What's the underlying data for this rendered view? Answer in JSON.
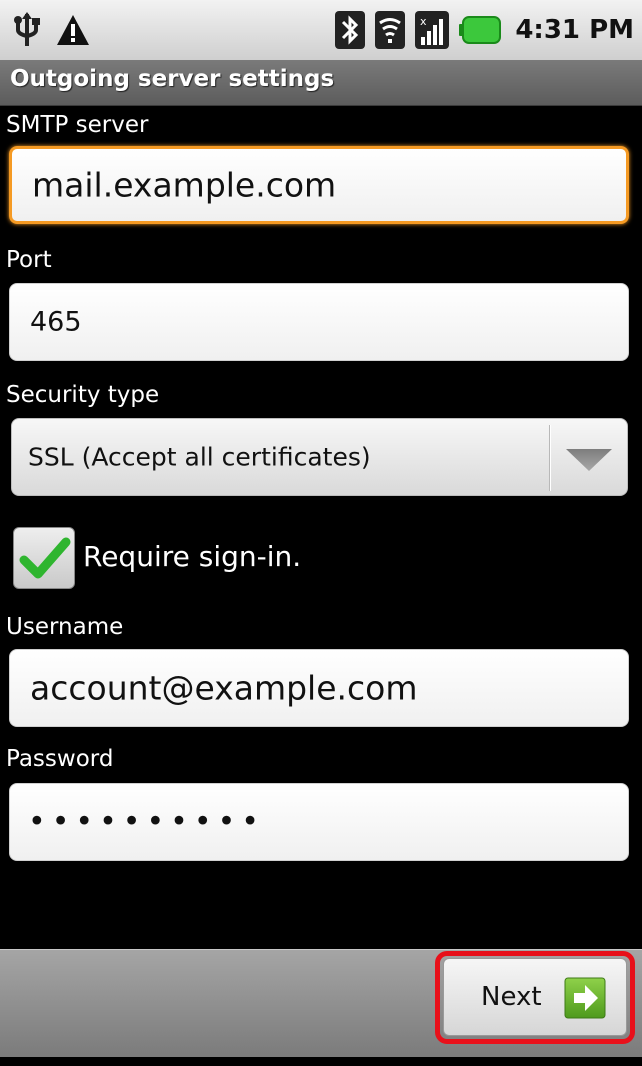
{
  "status_bar": {
    "time": "4:31 PM",
    "icons": [
      "usb-icon",
      "warning-icon",
      "bluetooth-icon",
      "wifi-icon",
      "signal-icon",
      "battery-icon"
    ]
  },
  "title_bar": {
    "title": "Outgoing server settings"
  },
  "form": {
    "smtp_server": {
      "label": "SMTP server",
      "value": "mail.example.com"
    },
    "port": {
      "label": "Port",
      "value": "465"
    },
    "security_type": {
      "label": "Security type",
      "value": "SSL (Accept all certificates)"
    },
    "require_signin": {
      "label": "Require sign-in.",
      "checked": true
    },
    "username": {
      "label": "Username",
      "value": "account@example.com"
    },
    "password": {
      "label": "Password",
      "value": "••••••••••"
    }
  },
  "bottom_bar": {
    "next_label": "Next"
  },
  "colors": {
    "focus": "#f59a23",
    "highlight": "#e8101a",
    "check": "#2fb52f",
    "battery": "#3cc83c",
    "next_icon": "#6ab82c"
  }
}
